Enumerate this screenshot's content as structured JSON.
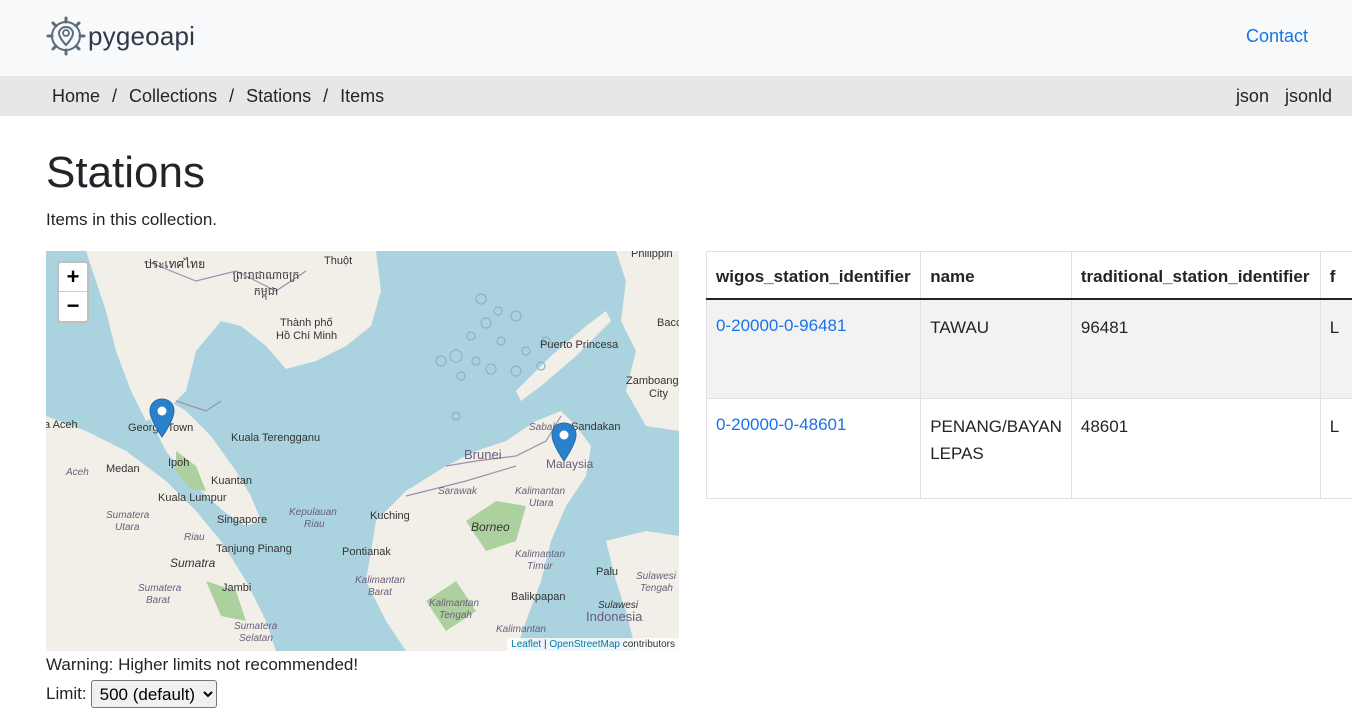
{
  "header": {
    "logo_text": "pygeoapi",
    "contact_label": "Contact"
  },
  "breadcrumb": {
    "items": [
      "Home",
      "Collections",
      "Stations",
      "Items"
    ],
    "separator": "/"
  },
  "formats": [
    "json",
    "jsonld"
  ],
  "page": {
    "title": "Stations",
    "subtitle": "Items in this collection."
  },
  "map": {
    "zoom_in": "+",
    "zoom_out": "−",
    "attribution_leaflet": "Leaflet",
    "attribution_sep": " | ",
    "attribution_osm": "OpenStreetMap",
    "attribution_suffix": " contributors",
    "labels": {
      "thailand": "ประเทศไทย",
      "cambodia": "ព្រះរាជាណាចក្រ កម្ពុជា",
      "thuot": "Thuột",
      "hcm1": "Thành phố",
      "hcm2": "Hồ Chí Minh",
      "philippines": "Philippin",
      "baco": "Bacc",
      "puerto": "Puerto Princesa",
      "zambo1": "Zamboang",
      "zambo2": "City",
      "aceh": "a Aceh",
      "george": "George Town",
      "kt": "Kuala Terengganu",
      "brunei": "Brunei",
      "sabah": "Sabah",
      "sandakan": "Sandakan",
      "malaysia": "Malaysia",
      "medan": "Medan",
      "ipoh": "Ipoh",
      "aceh2": "Aceh",
      "kuantan": "Kuantan",
      "kl": "Kuala Lumpur",
      "sarawak": "Sarawak",
      "kalut1": "Kalimantan",
      "kalut2": "Utara",
      "sumut1": "Sumatera",
      "sumut2": "Utara",
      "singapore": "Singapore",
      "kr1": "Kepulauan",
      "kr2": "Riau",
      "kuching": "Kuching",
      "borneo": "Borneo",
      "riau": "Riau",
      "tp": "Tanjung Pinang",
      "pontianak": "Pontianak",
      "kaltim1": "Kalimantan",
      "kaltim2": "Timur",
      "sumatra": "Sumatra",
      "palu": "Palu",
      "sulteng1": "Sulawesi",
      "sulteng2": "Tengah",
      "sumbar1": "Sumatera",
      "sumbar2": "Barat",
      "jambi": "Jambi",
      "kalbar1": "Kalimantan",
      "kalbar2": "Barat",
      "balikpapan": "Balikpapan",
      "kalteng1": "Kalimantan",
      "kalteng2": "Tengah",
      "sulawesi": "Sulawesi",
      "indonesia": "Indonesia",
      "sumsel1": "Sumatera",
      "sumsel2": "Selatan",
      "kalsel": "Kalimantan"
    }
  },
  "warning": "Warning: Higher limits not recommended!",
  "limit": {
    "label": "Limit:",
    "selected": "500 (default)"
  },
  "table": {
    "headers": [
      "wigos_station_identifier",
      "name",
      "traditional_station_identifier",
      "f"
    ],
    "rows": [
      [
        "0-20000-0-96481",
        "TAWAU",
        "96481",
        "L"
      ],
      [
        "0-20000-0-48601",
        "PENANG/BAYAN LEPAS",
        "48601",
        "L"
      ]
    ]
  },
  "colors": {
    "link": "#1a73e8",
    "water": "#aad3df",
    "land": "#f2efe9",
    "forest": "#add19e",
    "marker": "#2a81cb"
  }
}
